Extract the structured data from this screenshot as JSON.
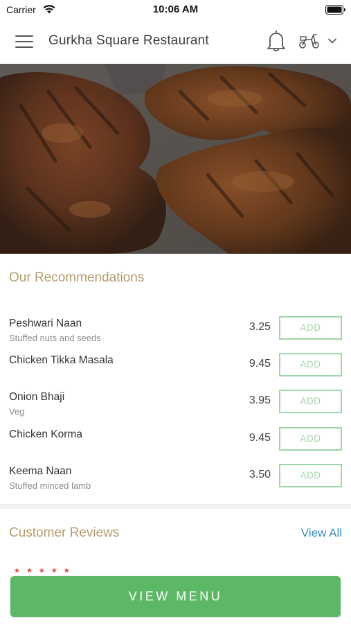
{
  "status_bar": {
    "carrier": "Carrier",
    "time": "10:06 AM"
  },
  "header": {
    "title": "Gurkha Square Restaurant",
    "icons": [
      "menu-icon",
      "bell-icon",
      "scooter-icon",
      "chevron-down-icon"
    ]
  },
  "recommendations": {
    "title": "Our Recommendations",
    "add_label": "ADD",
    "items": [
      {
        "name": "Peshwari Naan",
        "description": "Stuffed nuts and seeds",
        "price": "3.25"
      },
      {
        "name": "Chicken Tikka Masala",
        "description": "",
        "price": "9.45"
      },
      {
        "name": "Onion Bhaji",
        "description": "Veg",
        "price": "3.95"
      },
      {
        "name": "Chicken Korma",
        "description": "",
        "price": "9.45"
      },
      {
        "name": "Keema Naan",
        "description": "Stuffed minced lamb",
        "price": "3.50"
      }
    ]
  },
  "reviews": {
    "title": "Customer Reviews",
    "view_all": "View All"
  },
  "footer": {
    "view_menu": "VIEW MENU"
  },
  "colors": {
    "accent_title": "#b59b6c",
    "add_button": "#9ed6a7",
    "view_menu_button": "#5cb865",
    "link": "#3b8fc4"
  }
}
